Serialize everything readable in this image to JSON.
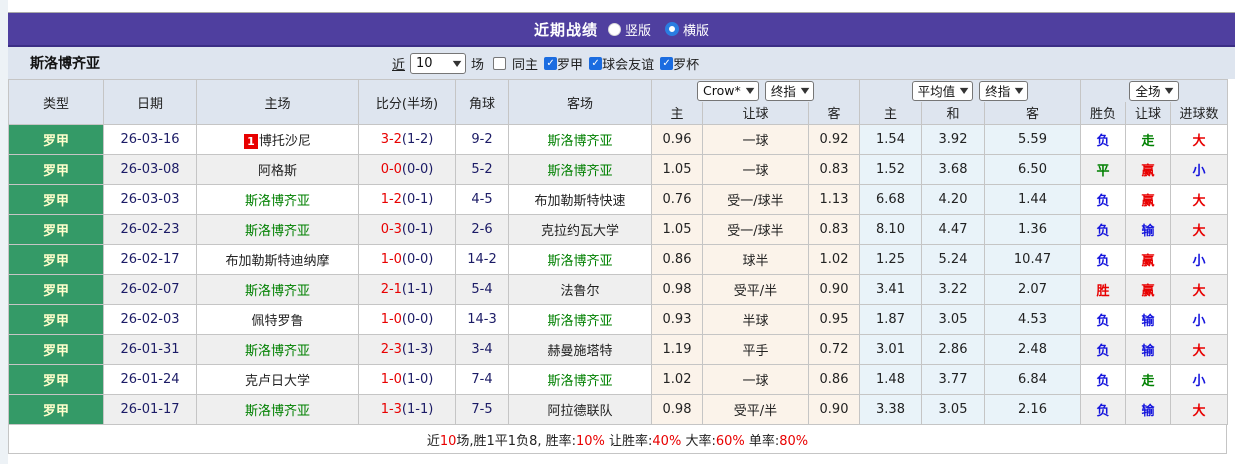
{
  "title_bar": {
    "title": "近期战绩",
    "radio_vertical": "竖版",
    "radio_horizontal": "横版",
    "selected": "横版",
    "bar_color": "#4f3f9f"
  },
  "filter": {
    "team": "斯洛博齐亚",
    "near_label": "近",
    "near_value": "10",
    "games_label": "场",
    "checkboxes": [
      {
        "label": "同主",
        "checked": false
      },
      {
        "label": "罗甲",
        "checked": true
      },
      {
        "label": "球会友谊",
        "checked": true
      },
      {
        "label": "罗杯",
        "checked": true
      }
    ]
  },
  "table": {
    "left_columns": [
      "类型",
      "日期",
      "主场",
      "比分(半场)",
      "角球",
      "客场"
    ],
    "selects": {
      "company": "Crow*",
      "company_final": "终指",
      "average": "平均值",
      "average_final": "终指",
      "scope": "全场"
    },
    "sub_columns": [
      "主",
      "让球",
      "客",
      "主",
      "和",
      "客",
      "胜负",
      "让球",
      "进球数"
    ],
    "rows": [
      {
        "type": "罗甲",
        "date": "26-03-16",
        "home": "博托沙尼",
        "home_badge": "1",
        "home_self": false,
        "score": "3-2",
        "half": "(1-2)",
        "corner": "9-2",
        "away": "斯洛博齐亚",
        "away_self": true,
        "crow": [
          "0.96",
          "一球",
          "0.92"
        ],
        "avg": [
          "1.54",
          "3.92",
          "5.59"
        ],
        "result": {
          "text": "负",
          "color": "blue"
        },
        "handicap": {
          "text": "走",
          "color": "green"
        },
        "goals": {
          "text": "大",
          "color": "red"
        }
      },
      {
        "type": "罗甲",
        "date": "26-03-08",
        "home": "阿格斯",
        "home_badge": "",
        "home_self": false,
        "score": "0-0",
        "half": "(0-0)",
        "corner": "5-2",
        "away": "斯洛博齐亚",
        "away_self": true,
        "crow": [
          "1.05",
          "一球",
          "0.83"
        ],
        "avg": [
          "1.52",
          "3.68",
          "6.50"
        ],
        "result": {
          "text": "平",
          "color": "green"
        },
        "handicap": {
          "text": "赢",
          "color": "red"
        },
        "goals": {
          "text": "小",
          "color": "blue"
        }
      },
      {
        "type": "罗甲",
        "date": "26-03-03",
        "home": "斯洛博齐亚",
        "home_badge": "",
        "home_self": true,
        "score": "1-2",
        "half": "(0-1)",
        "corner": "4-5",
        "away": "布加勒斯特快速",
        "away_self": false,
        "crow": [
          "0.76",
          "受一/球半",
          "1.13"
        ],
        "avg": [
          "6.68",
          "4.20",
          "1.44"
        ],
        "result": {
          "text": "负",
          "color": "blue"
        },
        "handicap": {
          "text": "赢",
          "color": "red"
        },
        "goals": {
          "text": "大",
          "color": "red"
        }
      },
      {
        "type": "罗甲",
        "date": "26-02-23",
        "home": "斯洛博齐亚",
        "home_badge": "",
        "home_self": true,
        "score": "0-3",
        "half": "(0-1)",
        "corner": "2-6",
        "away": "克拉约瓦大学",
        "away_self": false,
        "crow": [
          "1.05",
          "受一/球半",
          "0.83"
        ],
        "avg": [
          "8.10",
          "4.47",
          "1.36"
        ],
        "result": {
          "text": "负",
          "color": "blue"
        },
        "handicap": {
          "text": "输",
          "color": "blue"
        },
        "goals": {
          "text": "大",
          "color": "red"
        }
      },
      {
        "type": "罗甲",
        "date": "26-02-17",
        "home": "布加勒斯特迪纳摩",
        "home_badge": "",
        "home_self": false,
        "score": "1-0",
        "half": "(0-0)",
        "corner": "14-2",
        "away": "斯洛博齐亚",
        "away_self": true,
        "crow": [
          "0.86",
          "球半",
          "1.02"
        ],
        "avg": [
          "1.25",
          "5.24",
          "10.47"
        ],
        "result": {
          "text": "负",
          "color": "blue"
        },
        "handicap": {
          "text": "赢",
          "color": "red"
        },
        "goals": {
          "text": "小",
          "color": "blue"
        }
      },
      {
        "type": "罗甲",
        "date": "26-02-07",
        "home": "斯洛博齐亚",
        "home_badge": "",
        "home_self": true,
        "score": "2-1",
        "half": "(1-1)",
        "corner": "5-4",
        "away": "法鲁尔",
        "away_self": false,
        "crow": [
          "0.98",
          "受平/半",
          "0.90"
        ],
        "avg": [
          "3.41",
          "3.22",
          "2.07"
        ],
        "result": {
          "text": "胜",
          "color": "red"
        },
        "handicap": {
          "text": "赢",
          "color": "red"
        },
        "goals": {
          "text": "大",
          "color": "red"
        }
      },
      {
        "type": "罗甲",
        "date": "26-02-03",
        "home": "佩特罗鲁",
        "home_badge": "",
        "home_self": false,
        "score": "1-0",
        "half": "(0-0)",
        "corner": "14-3",
        "away": "斯洛博齐亚",
        "away_self": true,
        "crow": [
          "0.93",
          "半球",
          "0.95"
        ],
        "avg": [
          "1.87",
          "3.05",
          "4.53"
        ],
        "result": {
          "text": "负",
          "color": "blue"
        },
        "handicap": {
          "text": "输",
          "color": "blue"
        },
        "goals": {
          "text": "小",
          "color": "blue"
        }
      },
      {
        "type": "罗甲",
        "date": "26-01-31",
        "home": "斯洛博齐亚",
        "home_badge": "",
        "home_self": true,
        "score": "2-3",
        "half": "(1-3)",
        "corner": "3-4",
        "away": "赫曼施塔特",
        "away_self": false,
        "crow": [
          "1.19",
          "平手",
          "0.72"
        ],
        "avg": [
          "3.01",
          "2.86",
          "2.48"
        ],
        "result": {
          "text": "负",
          "color": "blue"
        },
        "handicap": {
          "text": "输",
          "color": "blue"
        },
        "goals": {
          "text": "大",
          "color": "red"
        }
      },
      {
        "type": "罗甲",
        "date": "26-01-24",
        "home": "克卢日大学",
        "home_badge": "",
        "home_self": false,
        "score": "1-0",
        "half": "(1-0)",
        "corner": "7-4",
        "away": "斯洛博齐亚",
        "away_self": true,
        "crow": [
          "1.02",
          "一球",
          "0.86"
        ],
        "avg": [
          "1.48",
          "3.77",
          "6.84"
        ],
        "result": {
          "text": "负",
          "color": "blue"
        },
        "handicap": {
          "text": "走",
          "color": "green"
        },
        "goals": {
          "text": "小",
          "color": "blue"
        }
      },
      {
        "type": "罗甲",
        "date": "26-01-17",
        "home": "斯洛博齐亚",
        "home_badge": "",
        "home_self": true,
        "score": "1-3",
        "half": "(1-1)",
        "corner": "7-5",
        "away": "阿拉德联队",
        "away_self": false,
        "crow": [
          "0.98",
          "受平/半",
          "0.90"
        ],
        "avg": [
          "3.38",
          "3.05",
          "2.16"
        ],
        "result": {
          "text": "负",
          "color": "blue"
        },
        "handicap": {
          "text": "输",
          "color": "blue"
        },
        "goals": {
          "text": "大",
          "color": "red"
        }
      }
    ]
  },
  "summary": {
    "segments": [
      {
        "text": "近",
        "red": false
      },
      {
        "text": "10",
        "red": true
      },
      {
        "text": "场,胜1平1负8, 胜率:",
        "red": false
      },
      {
        "text": "10%",
        "red": true
      },
      {
        "text": " 让胜率:",
        "red": false
      },
      {
        "text": "40%",
        "red": true
      },
      {
        "text": " 大率:",
        "red": false
      },
      {
        "text": "60%",
        "red": true
      },
      {
        "text": " 单率:",
        "red": false
      },
      {
        "text": "80%",
        "red": true
      }
    ]
  }
}
